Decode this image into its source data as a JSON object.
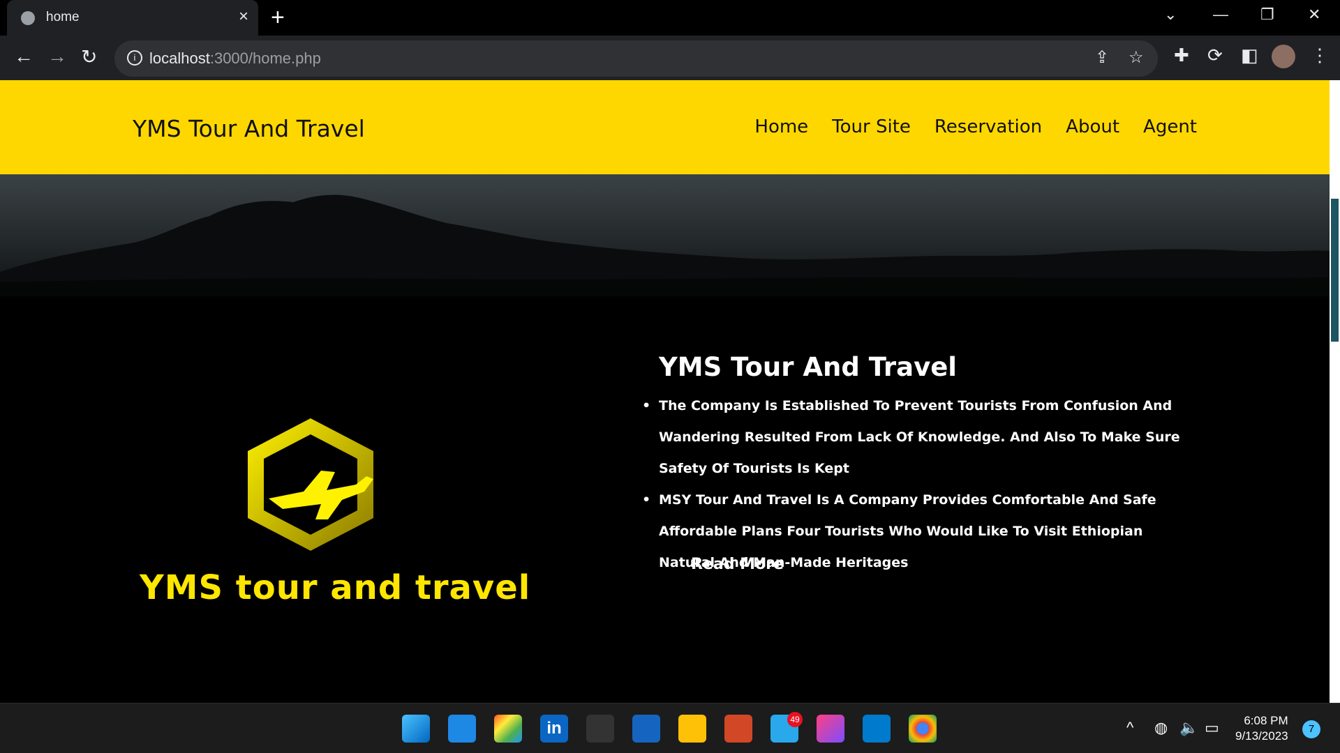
{
  "browser": {
    "tab_title": "home",
    "url_host": "localhost",
    "url_rest": ":3000/home.php"
  },
  "site": {
    "brand": "YMS Tour And Travel",
    "nav": [
      "Home",
      "Tour Site",
      "Reservation",
      "About",
      "Agent"
    ]
  },
  "about": {
    "logo_text": "YMS tour and travel",
    "title": "YMS Tour And Travel",
    "points": [
      "The Company Is Established To Prevent Tourists From Confusion And Wandering Resulted From Lack Of Knowledge. And Also To Make Sure Safety Of Tourists Is Kept",
      "MSY Tour And Travel Is A Company Provides Comfortable And Safe Affordable Plans Four Tourists Who Would Like To Visit Ethiopian Natural And Man-Made Heritages"
    ],
    "read_more": "Read More"
  },
  "taskbar": {
    "telegram_badge": "49",
    "time": "6:08 PM",
    "date": "9/13/2023",
    "notification_count": "7"
  },
  "colors": {
    "header_bg": "#ffd700",
    "page_bg": "#000000",
    "logo_yellow": "#ffe600"
  }
}
